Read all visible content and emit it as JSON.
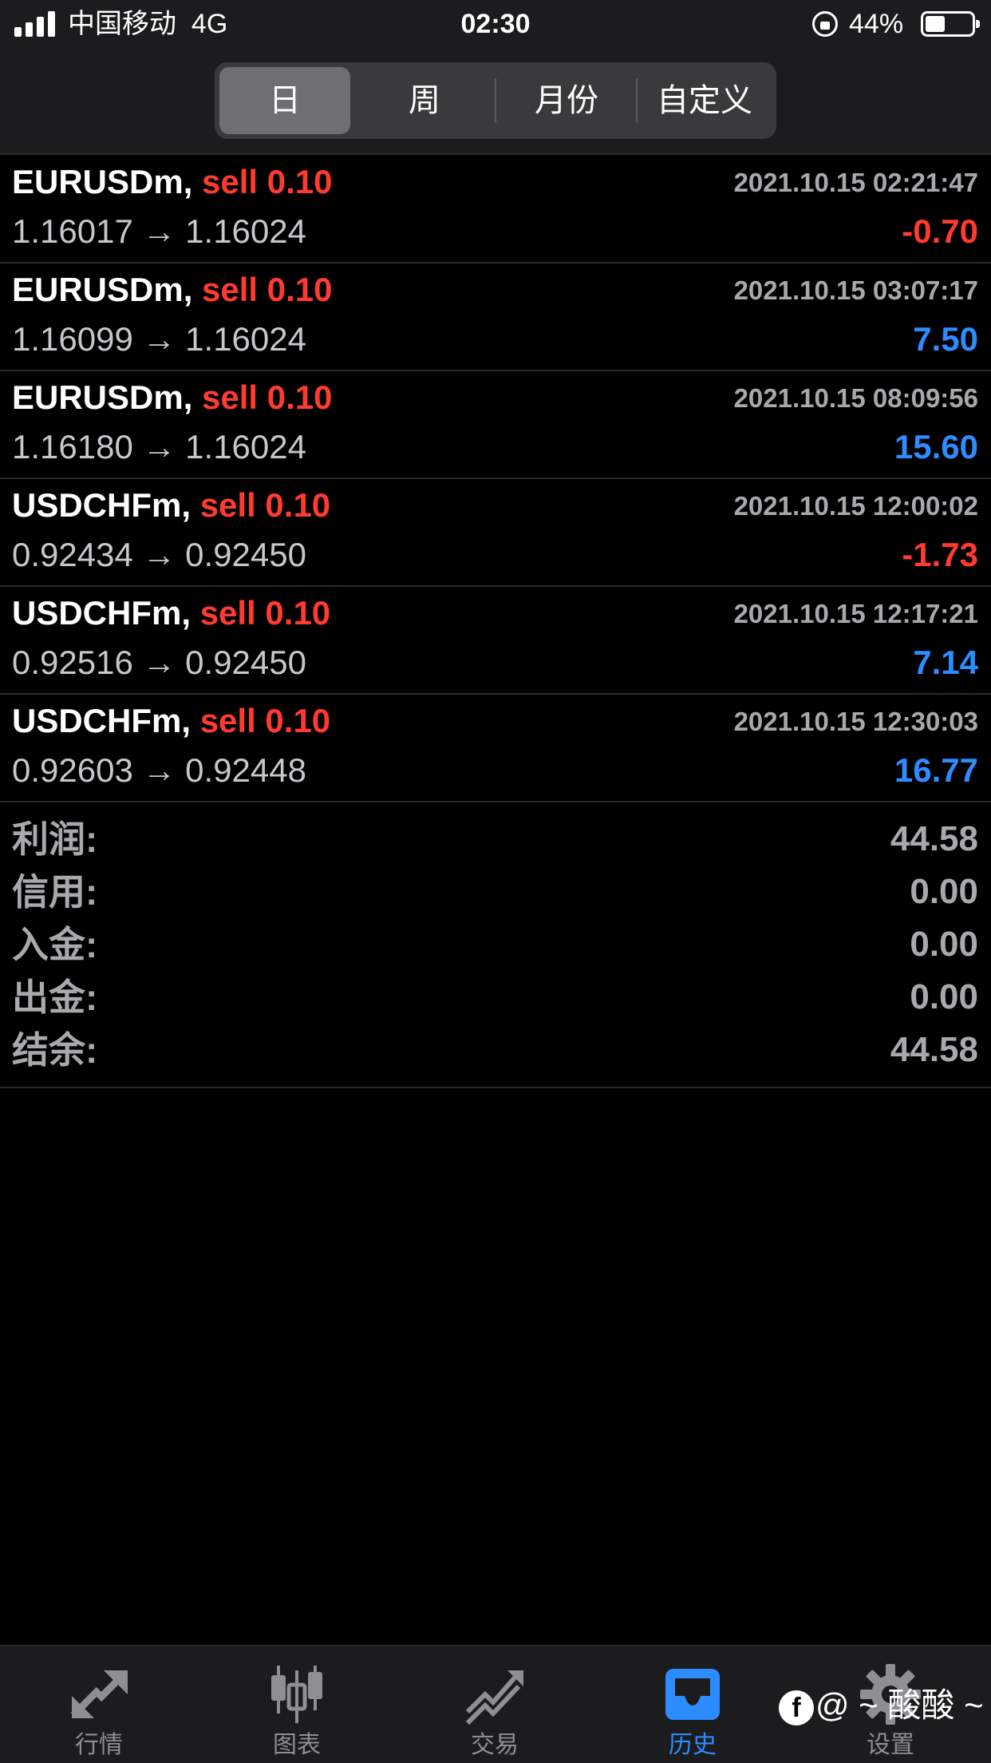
{
  "status_bar": {
    "carrier": "中国移动",
    "network": "4G",
    "time": "02:30",
    "battery": "44%"
  },
  "segments": [
    {
      "label": "日",
      "active": true
    },
    {
      "label": "周",
      "active": false
    },
    {
      "label": "月份",
      "active": false
    },
    {
      "label": "自定义",
      "active": false
    }
  ],
  "trades": [
    {
      "symbol": "EURUSDm,",
      "type": "sell",
      "volume": "0.10",
      "open_price": "1.16017",
      "close_price": "1.16024",
      "time": "2021.10.15 02:21:47",
      "profit": "-0.70",
      "profit_sign": "neg"
    },
    {
      "symbol": "EURUSDm,",
      "type": "sell",
      "volume": "0.10",
      "open_price": "1.16099",
      "close_price": "1.16024",
      "time": "2021.10.15 03:07:17",
      "profit": "7.50",
      "profit_sign": "pos"
    },
    {
      "symbol": "EURUSDm,",
      "type": "sell",
      "volume": "0.10",
      "open_price": "1.16180",
      "close_price": "1.16024",
      "time": "2021.10.15 08:09:56",
      "profit": "15.60",
      "profit_sign": "pos"
    },
    {
      "symbol": "USDCHFm,",
      "type": "sell",
      "volume": "0.10",
      "open_price": "0.92434",
      "close_price": "0.92450",
      "time": "2021.10.15 12:00:02",
      "profit": "-1.73",
      "profit_sign": "neg"
    },
    {
      "symbol": "USDCHFm,",
      "type": "sell",
      "volume": "0.10",
      "open_price": "0.92516",
      "close_price": "0.92450",
      "time": "2021.10.15 12:17:21",
      "profit": "7.14",
      "profit_sign": "pos"
    },
    {
      "symbol": "USDCHFm,",
      "type": "sell",
      "volume": "0.10",
      "open_price": "0.92603",
      "close_price": "0.92448",
      "time": "2021.10.15 12:30:03",
      "profit": "16.77",
      "profit_sign": "pos"
    }
  ],
  "arrow": "→",
  "summary": [
    {
      "label": "利润:",
      "value": "44.58"
    },
    {
      "label": "信用:",
      "value": "0.00"
    },
    {
      "label": "入金:",
      "value": "0.00"
    },
    {
      "label": "出金:",
      "value": "0.00"
    },
    {
      "label": "结余:",
      "value": "44.58"
    }
  ],
  "tabbar": [
    {
      "label": "行情",
      "icon": "quotes-arrows-icon",
      "active": false
    },
    {
      "label": "图表",
      "icon": "candlestick-chart-icon",
      "active": false
    },
    {
      "label": "交易",
      "icon": "trade-trend-icon",
      "active": false
    },
    {
      "label": "历史",
      "icon": "history-inbox-icon",
      "active": true
    },
    {
      "label": "设置",
      "icon": "gear-icon",
      "active": false
    }
  ],
  "watermark": {
    "text": "@ ~ 酸酸 ~"
  },
  "colors": {
    "sell": "#ff3b30",
    "loss": "#ff3b30",
    "profit": "#2d8cff",
    "active_tab": "#2d8cff",
    "background": "#000000",
    "header": "#1c1c1e"
  }
}
